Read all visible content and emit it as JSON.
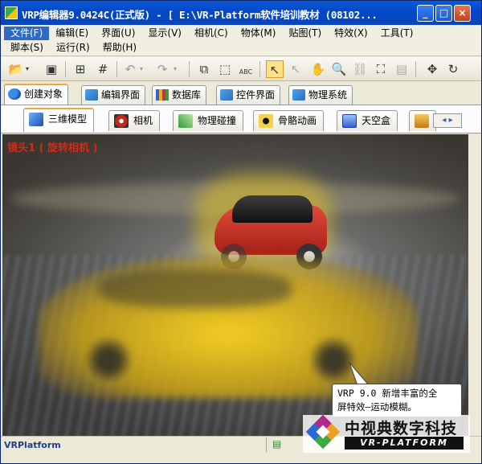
{
  "window": {
    "title": "VRP编辑器9.0424C(正式版) - [ E:\\VR-Platform软件培训教材 (08102...",
    "minimize_glyph": "_",
    "maximize_glyph": "□",
    "close_glyph": "×"
  },
  "menu": {
    "row1": [
      {
        "label": "文件(F)",
        "active": true
      },
      {
        "label": "编辑(E)"
      },
      {
        "label": "界面(U)"
      },
      {
        "label": "显示(V)"
      },
      {
        "label": "相机(C)"
      },
      {
        "label": "物体(M)"
      },
      {
        "label": "贴图(T)"
      },
      {
        "label": "特效(X)"
      },
      {
        "label": "工具(T)"
      }
    ],
    "row2": [
      {
        "label": "脚本(S)"
      },
      {
        "label": "运行(R)"
      },
      {
        "label": "帮助(H)"
      }
    ]
  },
  "toolbar": {
    "icons": [
      "open-folder",
      "save",
      "grid",
      "hash-grid",
      "undo",
      "redo",
      "copy",
      "select-box",
      "select-abc",
      "pointer",
      "pointer-plus",
      "hand",
      "zoom",
      "link",
      "fit",
      "frame",
      "move",
      "rotate"
    ],
    "abc_label": "ABC"
  },
  "tabs_main": [
    {
      "label": "创建对象",
      "active": true,
      "icon": "create-object-icon"
    },
    {
      "label": "编辑界面",
      "icon": "edit-ui-icon"
    },
    {
      "label": "数据库",
      "icon": "database-icon"
    },
    {
      "label": "控件界面",
      "icon": "control-ui-icon"
    },
    {
      "label": "物理系统",
      "icon": "physics-system-icon"
    }
  ],
  "tabs_sub": [
    {
      "label": "三维模型",
      "active": true,
      "icon": "cube-model-icon",
      "color": "#2a6ad8"
    },
    {
      "label": "相机",
      "icon": "camera-icon",
      "color": "#c42a1c"
    },
    {
      "label": "物理碰撞",
      "icon": "collision-icon",
      "color": "#2f9a3a"
    },
    {
      "label": "骨骼动画",
      "icon": "skeleton-anim-icon",
      "color": "#111111"
    },
    {
      "label": "天空盒",
      "icon": "skybox-icon",
      "color": "#3a5fd0"
    },
    {
      "label": "",
      "icon": "landscape-icon",
      "color": "#f0a020"
    }
  ],
  "tabs_sub_scroll": "◂ ▸",
  "viewport": {
    "camera_label": "镜头1 ( 旋转相机 )",
    "callout_line1": "VRP 9.0 新增丰富的全",
    "callout_line2": "屏特效—运动模糊。"
  },
  "logo": {
    "chinese": "中视典数字科技",
    "english": "VR-PLATFORM"
  },
  "statusbar": {
    "text": "VRPlatform",
    "icon": "status-grid-icon"
  },
  "colors": {
    "titlebar": "#0348c9",
    "accent_tab": "#f7a43a",
    "camera_label": "#d42a17"
  }
}
